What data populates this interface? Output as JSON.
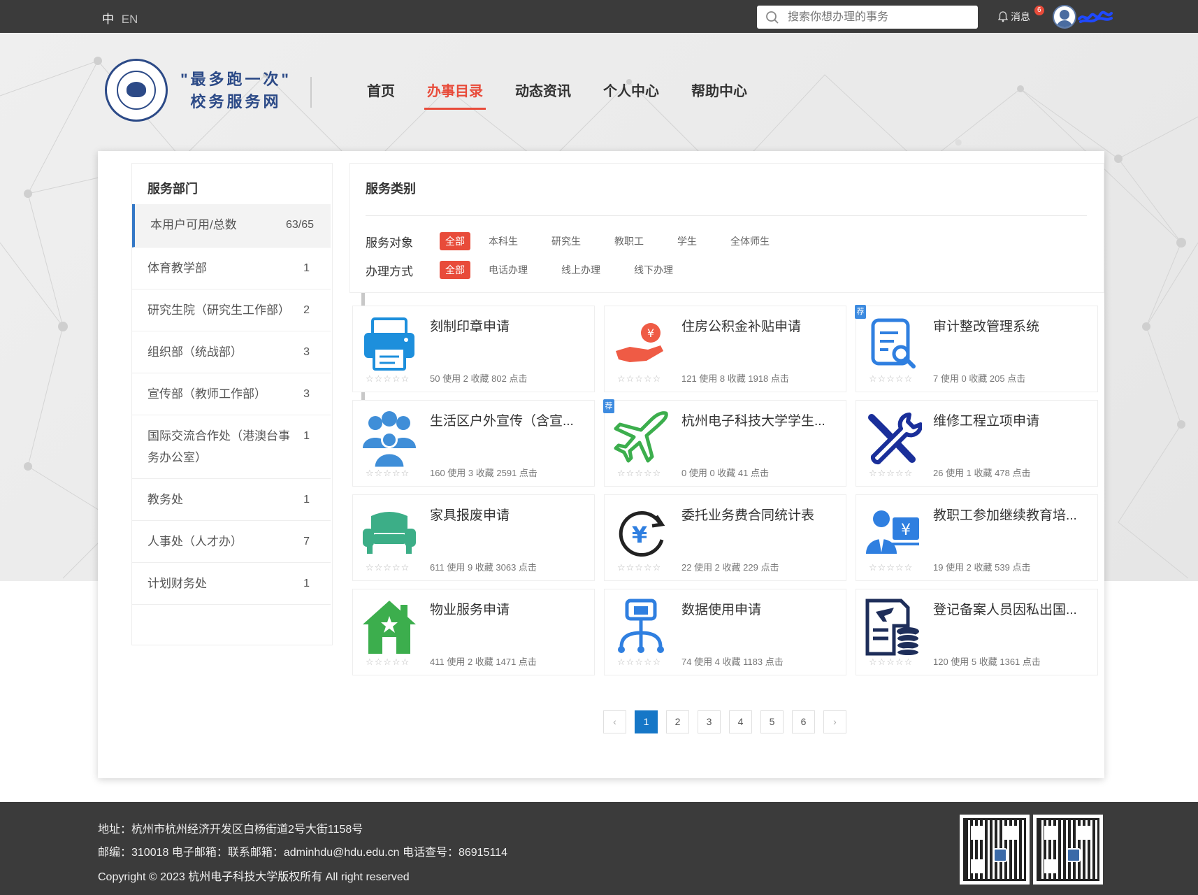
{
  "topbar": {
    "lang_zh": "中",
    "lang_en": "EN",
    "search_placeholder": "搜索你想办理的事务",
    "messages_label": "消息",
    "messages_count": "6"
  },
  "logo": {
    "line1": "\"最多跑一次\"",
    "line2": "校务服务网"
  },
  "nav": [
    {
      "label": "首页"
    },
    {
      "label": "办事目录",
      "active": true
    },
    {
      "label": "动态资讯"
    },
    {
      "label": "个人中心"
    },
    {
      "label": "帮助中心"
    }
  ],
  "dept": {
    "title": "服务部门",
    "items": [
      {
        "name": "本用户可用/总数",
        "count": "63/65"
      },
      {
        "name": "体育教学部",
        "count": "1"
      },
      {
        "name": "研究生院（研究生工作部）",
        "count": "2"
      },
      {
        "name": "组织部（统战部）",
        "count": "3"
      },
      {
        "name": "宣传部（教师工作部）",
        "count": "3"
      },
      {
        "name": "国际交流合作处（港澳台事务办公室）",
        "count": "1"
      },
      {
        "name": "教务处",
        "count": "1"
      },
      {
        "name": "人事处（人才办）",
        "count": "7"
      },
      {
        "name": "计划财务处",
        "count": "1"
      }
    ]
  },
  "category": {
    "title": "服务类别",
    "target_label": "服务对象",
    "target_options": [
      "全部",
      "本科生",
      "研究生",
      "教职工",
      "学生",
      "全体师生"
    ],
    "method_label": "办理方式",
    "method_options": [
      "全部",
      "电话办理",
      "线上办理",
      "线下办理"
    ]
  },
  "tiles": [
    {
      "name": "刻制印章申请",
      "stats": "50 使用 2 收藏 802 点击",
      "icon": "printer-icon",
      "rec": false
    },
    {
      "name": "住房公积金补贴申请",
      "stats": "121 使用 8 收藏 1918 点击",
      "icon": "hand-money-icon",
      "rec": false
    },
    {
      "name": "审计整改管理系统",
      "stats": "7 使用 0 收藏 205 点击",
      "icon": "document-search-icon",
      "rec": true
    },
    {
      "name": "生活区户外宣传（含宣...",
      "stats": "160 使用 3 收藏 2591 点击",
      "icon": "group-icon",
      "rec": false
    },
    {
      "name": "杭州电子科技大学学生...",
      "stats": "0 使用 0 收藏 41 点击",
      "icon": "airplane-icon",
      "rec": true
    },
    {
      "name": "维修工程立项申请",
      "stats": "26 使用 1 收藏 478 点击",
      "icon": "tools-icon",
      "rec": false
    },
    {
      "name": "家具报废申请",
      "stats": "611 使用 9 收藏 3063 点击",
      "icon": "sofa-icon",
      "rec": false
    },
    {
      "name": "委托业务费合同统计表",
      "stats": "22 使用 2 收藏 229 点击",
      "icon": "yuan-cycle-icon",
      "rec": false
    },
    {
      "name": "教职工参加继续教育培...",
      "stats": "19 使用 2 收藏 539 点击",
      "icon": "staff-money-icon",
      "rec": false
    },
    {
      "name": "物业服务申请",
      "stats": "411 使用 2 收藏 1471 点击",
      "icon": "house-star-icon",
      "rec": false
    },
    {
      "name": "数据使用申请",
      "stats": "74 使用 4 收藏 1183 点击",
      "icon": "network-icon",
      "rec": false
    },
    {
      "name": "登记备案人员因私出国...",
      "stats": "120 使用 5 收藏 1361 点击",
      "icon": "travel-doc-icon",
      "rec": false
    }
  ],
  "rec_label": "荐",
  "stars": "☆☆☆☆☆",
  "pager": {
    "pages": [
      "1",
      "2",
      "3",
      "4",
      "5",
      "6"
    ],
    "current": "1",
    "prev": "‹",
    "next": "›"
  },
  "footer": {
    "address": "地址：杭州市杭州经济开发区白杨街道2号大街1158号",
    "contact": "邮编：310018  电子邮箱：联系邮箱：adminhdu@hdu.edu.cn  电话查号：86915114",
    "copyright": "Copyright © 2023 杭州电子科技大学版权所有 All right reserved"
  },
  "colors": {
    "accent": "#e84b3a",
    "brand": "#2c4a87",
    "link_blue": "#1677c7"
  }
}
